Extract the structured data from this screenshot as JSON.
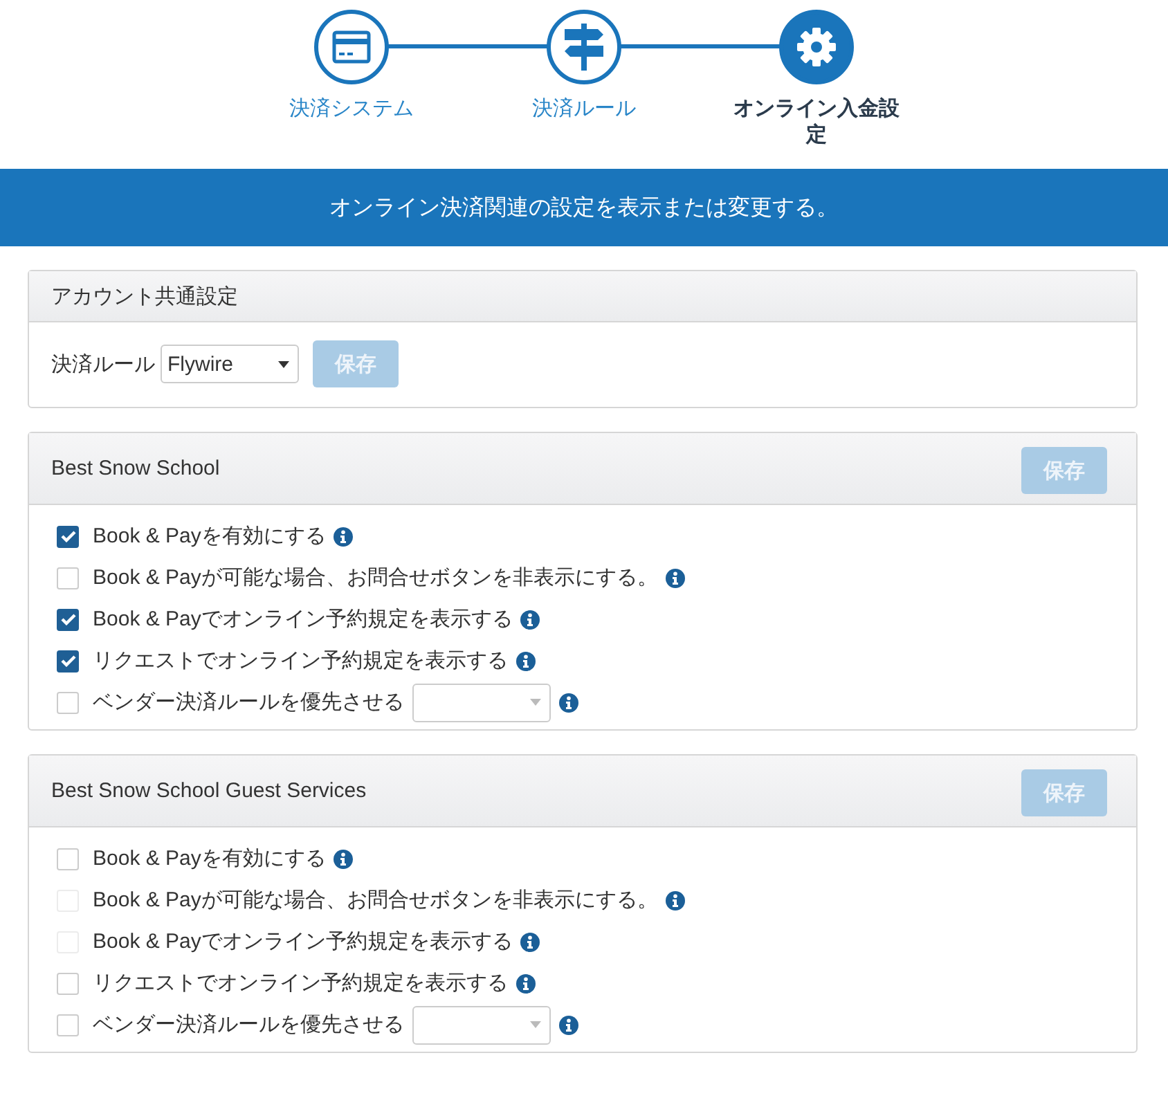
{
  "steps": [
    {
      "label": "決済システム",
      "selected": false
    },
    {
      "label": "決済ルール",
      "selected": false
    },
    {
      "label": "オンライン入金設定",
      "selected": true
    }
  ],
  "banner": "オンライン決済関連の設定を表示または変更する。",
  "account_settings": {
    "title": "アカウント共通設定",
    "field_label": "決済ルール",
    "select_value": "Flywire",
    "save_button": {
      "label": "保存",
      "disabled": true
    }
  },
  "sections": [
    {
      "title": "Best Snow School",
      "save_button": {
        "label": "保存",
        "disabled": true
      },
      "options": [
        {
          "kind": "checkbox",
          "label": "Book & Payを有効にする",
          "checked": true,
          "disabled": false
        },
        {
          "kind": "checkbox",
          "label": "Book & Payが可能な場合、お問合せボタンを非表示にする。",
          "checked": false,
          "disabled": false
        },
        {
          "kind": "checkbox",
          "label": "Book & Payでオンライン予約規定を表示する",
          "checked": true,
          "disabled": false
        },
        {
          "kind": "checkbox",
          "label": "リクエストでオンライン予約規定を表示する",
          "checked": true,
          "disabled": false
        },
        {
          "kind": "select",
          "label": "ベンダー決済ルールを優先させる",
          "checked": false,
          "disabled": false
        }
      ]
    },
    {
      "title": "Best Snow School Guest Services",
      "save_button": {
        "label": "保存",
        "disabled": true
      },
      "options": [
        {
          "kind": "checkbox",
          "label": "Book & Payを有効にする",
          "checked": false,
          "disabled": false
        },
        {
          "kind": "checkbox",
          "label": "Book & Payが可能な場合、お問合せボタンを非表示にする。",
          "checked": false,
          "disabled": true
        },
        {
          "kind": "checkbox",
          "label": "Book & Payでオンライン予約規定を表示する",
          "checked": false,
          "disabled": true
        },
        {
          "kind": "checkbox",
          "label": "リクエストでオンライン予約規定を表示する",
          "checked": false,
          "disabled": false
        },
        {
          "kind": "select",
          "label": "ベンダー決済ルールを優先させる",
          "checked": false,
          "disabled": false
        }
      ]
    }
  ]
}
